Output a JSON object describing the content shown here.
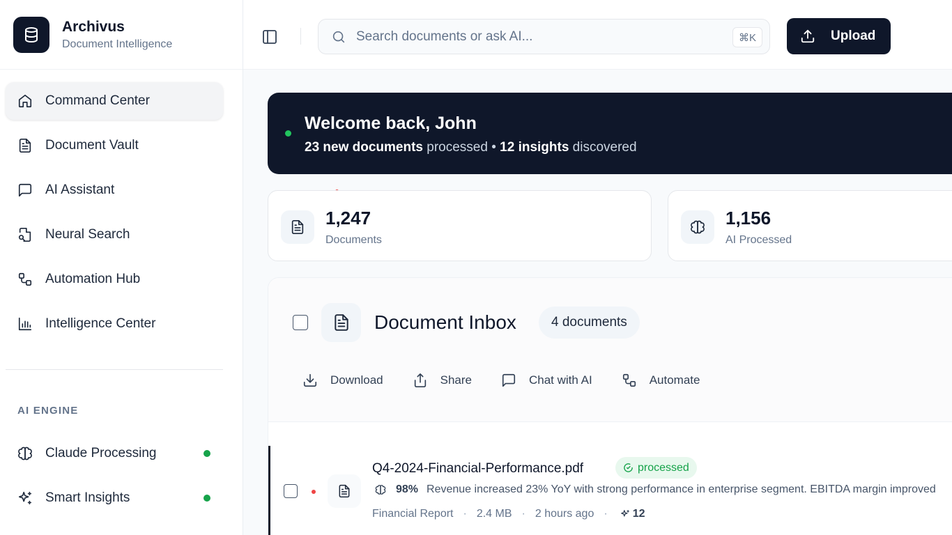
{
  "brand": {
    "name": "Archivus",
    "tagline": "Document Intelligence"
  },
  "sidebar": {
    "nav": [
      {
        "label": "Command Center",
        "icon": "home-icon",
        "active": true
      },
      {
        "label": "Document Vault",
        "icon": "file-text-icon"
      },
      {
        "label": "AI Assistant",
        "icon": "message-square-icon"
      },
      {
        "label": "Neural Search",
        "icon": "file-search-icon"
      },
      {
        "label": "Automation Hub",
        "icon": "workflow-icon"
      },
      {
        "label": "Intelligence Center",
        "icon": "bar-chart-icon"
      }
    ],
    "section_label": "AI ENGINE",
    "engine": [
      {
        "label": "Claude Processing",
        "icon": "brain-icon",
        "status": "active"
      },
      {
        "label": "Smart Insights",
        "icon": "sparkles-icon",
        "status": "active"
      }
    ]
  },
  "topbar": {
    "search_placeholder": "Search documents or ask AI...",
    "shortcut": "⌘K",
    "upload_label": "Upload"
  },
  "welcome": {
    "title": "Welcome back, John",
    "new_docs": "23 new documents",
    "processed_text": " processed • ",
    "insights": "12 insights",
    "discovered_text": " discovered"
  },
  "stats": [
    {
      "value": "1,247",
      "label": "Documents",
      "icon": "file-text-icon"
    },
    {
      "value": "1,156",
      "label": "AI Processed",
      "icon": "brain-icon"
    }
  ],
  "inbox": {
    "title": "Document Inbox",
    "count_label": "4 documents",
    "actions": [
      {
        "label": "Download",
        "icon": "download-icon"
      },
      {
        "label": "Share",
        "icon": "share-icon"
      },
      {
        "label": "Chat with AI",
        "icon": "message-square-icon"
      },
      {
        "label": "Automate",
        "icon": "workflow-icon"
      }
    ],
    "rows": [
      {
        "name": "Q4-2024-Financial-Performance.pdf",
        "status": "processed",
        "confidence": "98%",
        "summary": "Revenue increased 23% YoY with strong performance in enterprise segment. EBITDA margin improved",
        "type": "Financial Report",
        "size": "2.4 MB",
        "time": "2 hours ago",
        "insights": "12"
      }
    ]
  },
  "colors": {
    "primary": "#0f172a",
    "success": "#16a34a",
    "alert": "#ef4444"
  }
}
